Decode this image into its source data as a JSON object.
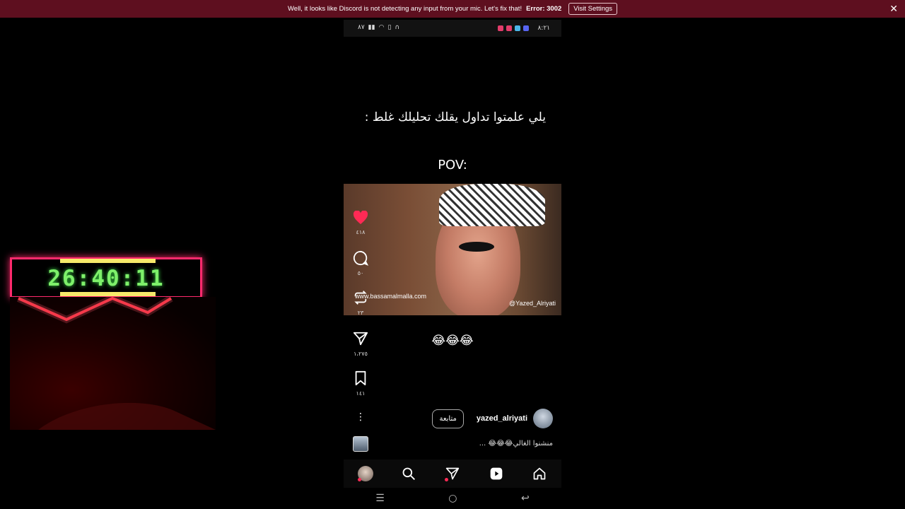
{
  "notice": {
    "message": "Well, it looks like Discord is not detecting any input from your mic. Let's fix that!",
    "error": "Error: 3002",
    "button": "Visit Settings",
    "close": "✕"
  },
  "timer": {
    "value": "26:40:11"
  },
  "status_bar": {
    "time": "٨:٢١",
    "battery": "٨٧"
  },
  "post": {
    "caption_top": "يلي علمتوا تداول يقلك تحليلك غلط :",
    "caption_pov": "POV:",
    "watermark_left": "www.bassamalmalla.com",
    "watermark_right": "@Yazed_Alriyati",
    "emoji_line": "😂😂😂",
    "author": "yazed_alriyati",
    "follow": "متابعة",
    "description": "منشنوا الغالي😂😂😂 ..."
  },
  "actions": {
    "likes": "٤١٨",
    "comments": "٥٠",
    "reposts": "٢٣",
    "shares": "١،٢٧٥",
    "saves": "١٤١"
  },
  "colors": {
    "notice_bg": "#5e0f1f",
    "timer_border": "#ff2a6d",
    "timer_text": "#7ef06a",
    "like": "#ff2a55"
  }
}
